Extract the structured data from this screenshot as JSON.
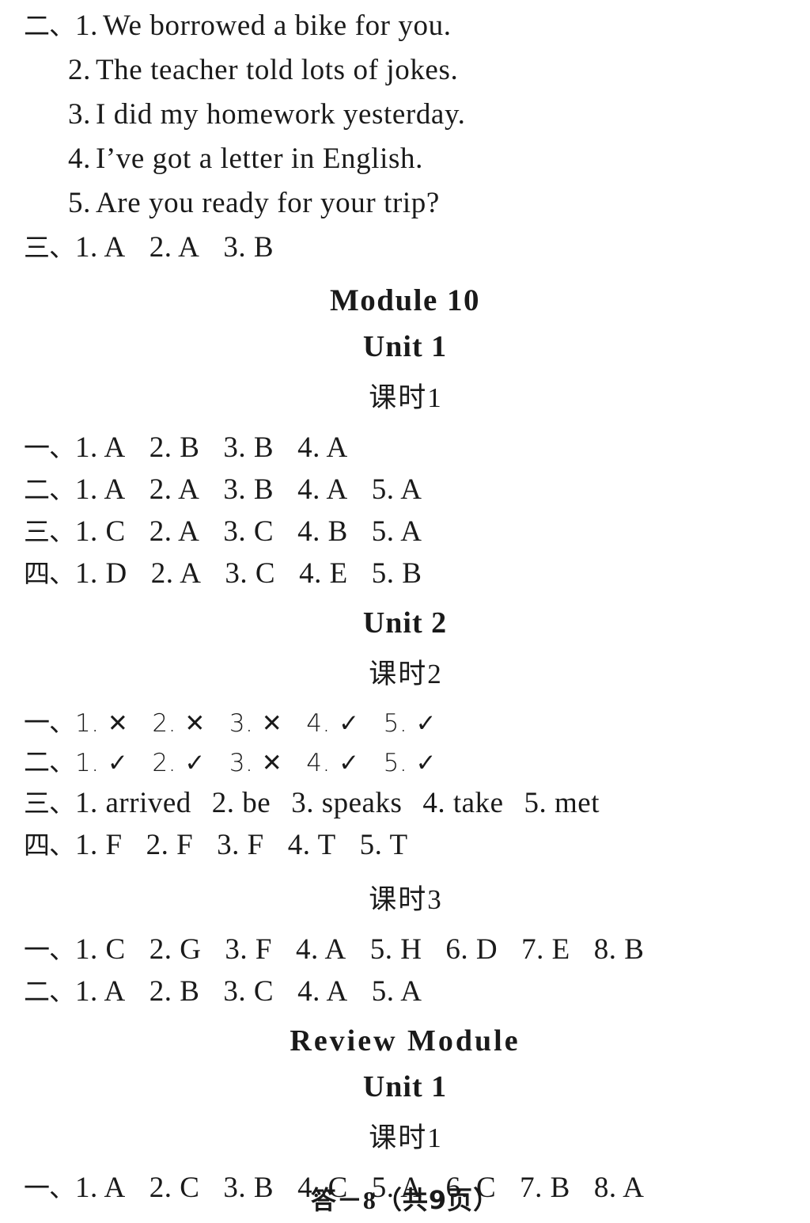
{
  "document": {
    "type": "answer-key",
    "page_footer": {
      "prefix": "答",
      "dash": "－",
      "page_number": "8",
      "total": "（共9页）"
    }
  },
  "top_block": {
    "section_two": {
      "ordinal": "二、",
      "items": [
        {
          "num": "1.",
          "text": "We borrowed a bike for you."
        },
        {
          "num": "2.",
          "text": "The teacher told lots of jokes."
        },
        {
          "num": "3.",
          "text": "I did my homework yesterday."
        },
        {
          "num": "4.",
          "text": "I’ve got a letter in English."
        },
        {
          "num": "5.",
          "text": "Are you ready for your trip?"
        }
      ]
    },
    "section_three": {
      "ordinal": "三、",
      "answers": [
        "1. A",
        "2. A",
        "3. B"
      ]
    }
  },
  "module10": {
    "heading": "Module 10",
    "unit1": {
      "heading": "Unit 1",
      "keshi": {
        "label": "课时",
        "num": "1"
      },
      "rows": [
        {
          "ordinal": "一、",
          "answers": [
            "1. A",
            "2. B",
            "3. B",
            "4. A"
          ]
        },
        {
          "ordinal": "二、",
          "answers": [
            "1. A",
            "2. A",
            "3. B",
            "4. A",
            "5. A"
          ]
        },
        {
          "ordinal": "三、",
          "answers": [
            "1. C",
            "2. A",
            "3. C",
            "4. B",
            "5. A"
          ]
        },
        {
          "ordinal": "四、",
          "answers": [
            "1. D",
            "2. A",
            "3. C",
            "4. E",
            "5. B"
          ]
        }
      ]
    },
    "unit2": {
      "heading": "Unit 2",
      "keshi2": {
        "label": "课时",
        "num": "2"
      },
      "rows_keshi2": [
        {
          "ordinal": "一、",
          "answers": [
            "1. ✕",
            "2. ✕",
            "3. ✕",
            "4. ✓",
            "5. ✓"
          ]
        },
        {
          "ordinal": "二、",
          "answers": [
            "1. ✓",
            "2. ✓",
            "3. ✕",
            "4. ✓",
            "5. ✓"
          ]
        },
        {
          "ordinal": "三、",
          "answers": [
            "1. arrived",
            "2. be",
            "3. speaks",
            "4. take",
            "5. met"
          ]
        },
        {
          "ordinal": "四、",
          "answers": [
            "1. F",
            "2. F",
            "3. F",
            "4. T",
            "5. T"
          ]
        }
      ],
      "keshi3": {
        "label": "课时",
        "num": "3"
      },
      "rows_keshi3": [
        {
          "ordinal": "一、",
          "answers": [
            "1. C",
            "2. G",
            "3. F",
            "4. A",
            "5. H",
            "6. D",
            "7. E",
            "8. B"
          ]
        },
        {
          "ordinal": "二、",
          "answers": [
            "1. A",
            "2. B",
            "3. C",
            "4. A",
            "5. A"
          ]
        }
      ]
    }
  },
  "review_module": {
    "heading": "Review Module",
    "unit1": {
      "heading": "Unit 1",
      "keshi": {
        "label": "课时",
        "num": "1"
      },
      "rows": [
        {
          "ordinal": "一、",
          "answers": [
            "1. A",
            "2. C",
            "3. B",
            "4. C",
            "5. A",
            "6. C",
            "7. B",
            "8. A"
          ]
        }
      ]
    }
  }
}
